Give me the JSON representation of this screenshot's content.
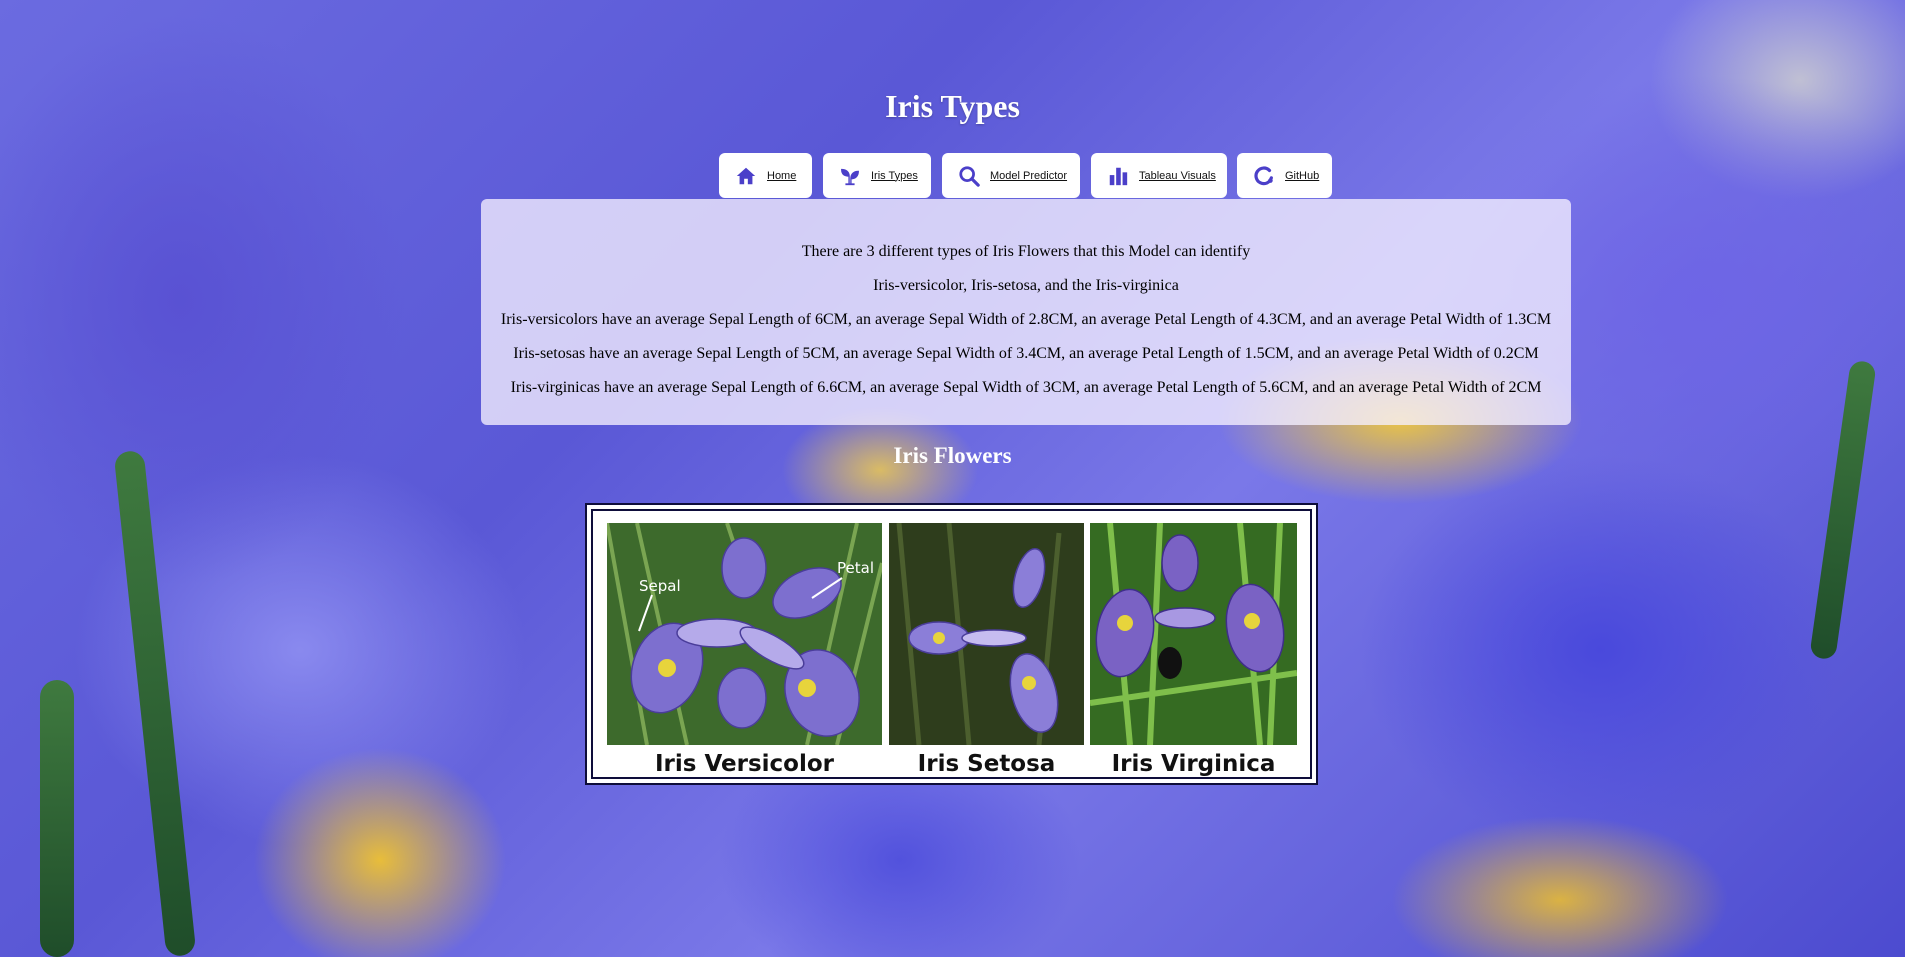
{
  "page": {
    "title": "Iris Types"
  },
  "nav": [
    {
      "label": "Home",
      "icon": "home-icon"
    },
    {
      "label": "Iris Types",
      "icon": "sprout-icon"
    },
    {
      "label": "Model Predictor",
      "icon": "search-icon"
    },
    {
      "label": "Tableau Visuals",
      "icon": "bar-chart-icon"
    },
    {
      "label": "GitHub",
      "icon": "github-icon"
    }
  ],
  "info": {
    "lines": [
      "There are 3 different types of Iris Flowers that this Model can identify",
      "Iris-versicolor, Iris-setosa, and the Iris-virginica",
      "Iris-versicolors have an average Sepal Length of 6CM, an average Sepal Width of 2.8CM, an average Petal Length of 4.3CM, and an average Petal Width of 1.3CM",
      "Iris-setosas have an average Sepal Length of 5CM, an average Sepal Width of 3.4CM, an average Petal Length of 1.5CM, and an average Petal Width of 0.2CM",
      "Iris-virginicas have an average Sepal Length of 6.6CM, an average Sepal Width of 3CM, an average Petal Length of 5.6CM, and an average Petal Width of 2CM"
    ]
  },
  "gallery": {
    "title": "Iris Flowers",
    "annotations": {
      "sepal": "Sepal",
      "petal": "Petal"
    },
    "items": [
      {
        "caption": "Iris Versicolor"
      },
      {
        "caption": "Iris Setosa"
      },
      {
        "caption": "Iris Virginica"
      }
    ]
  },
  "colors": {
    "accent": "#4b3fc9",
    "frame": "#0e0d3a",
    "panel": "#f5f0ff"
  }
}
